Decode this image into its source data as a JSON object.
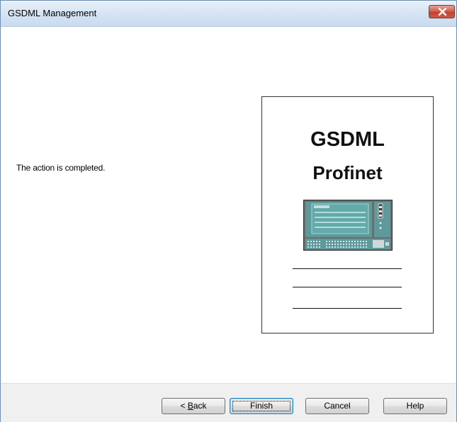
{
  "window": {
    "title": "GSDML Management"
  },
  "icons": {
    "close": "close-x-icon",
    "device": "plc-device-icon"
  },
  "colors": {
    "close_button": "#c9513d",
    "titlebar": "#d6e4f3",
    "device_panel": "#5f9fa0",
    "default_button_border": "#3c7fb1"
  },
  "main": {
    "status_message": "The action is completed."
  },
  "doc_panel": {
    "title_line1": "GSDML",
    "title_line2": "Profinet"
  },
  "footer": {
    "back_prefix": "< ",
    "back_mnemonic": "B",
    "back_rest": "ack",
    "finish_label": "Finish",
    "cancel_label": "Cancel",
    "help_label": "Help"
  }
}
